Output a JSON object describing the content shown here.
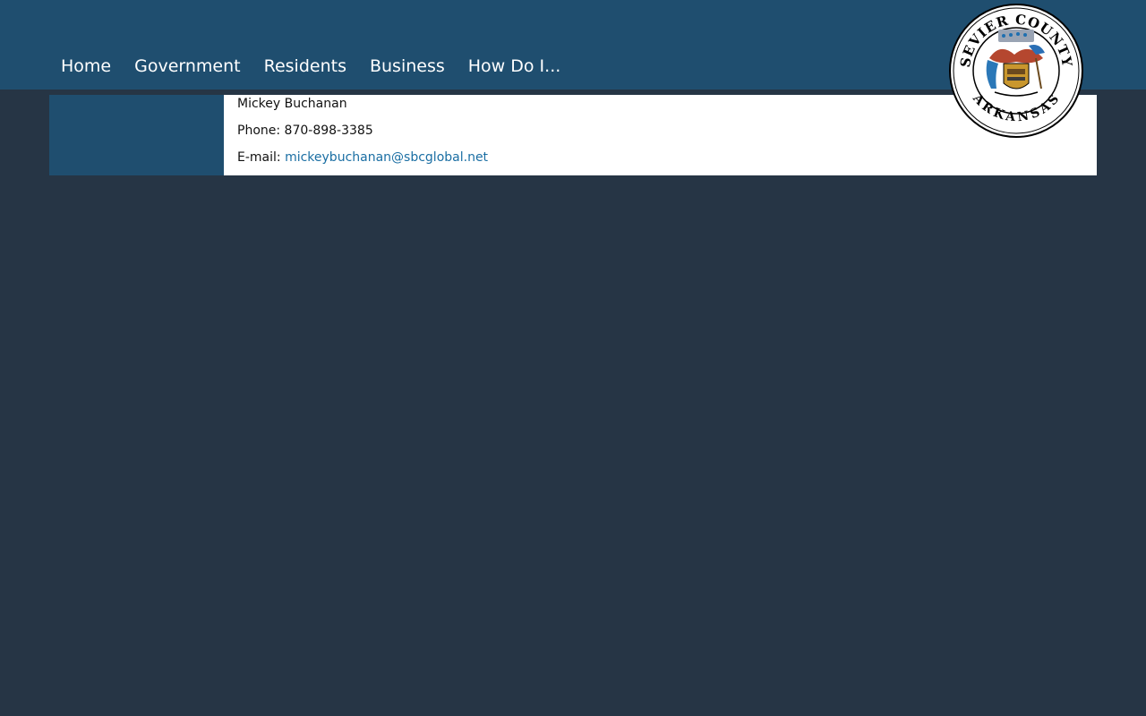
{
  "nav": {
    "items": [
      {
        "label": "Home"
      },
      {
        "label": "Government"
      },
      {
        "label": "Residents"
      },
      {
        "label": "Business"
      },
      {
        "label": "How Do I..."
      }
    ]
  },
  "seal": {
    "icon": "county-seal-icon",
    "top_text": "SEVIER COUNTY",
    "bottom_text": "ARKANSAS"
  },
  "contact": {
    "name": "Mickey Buchanan",
    "phone_label": "Phone:",
    "phone": "870-898-3385",
    "email_label": "E-mail:",
    "email": "mickeybuchanan@sbcglobal.net"
  },
  "colors": {
    "header_bg": "#1f4e6f",
    "page_bg": "#263545",
    "link": "#1a6ea3"
  }
}
